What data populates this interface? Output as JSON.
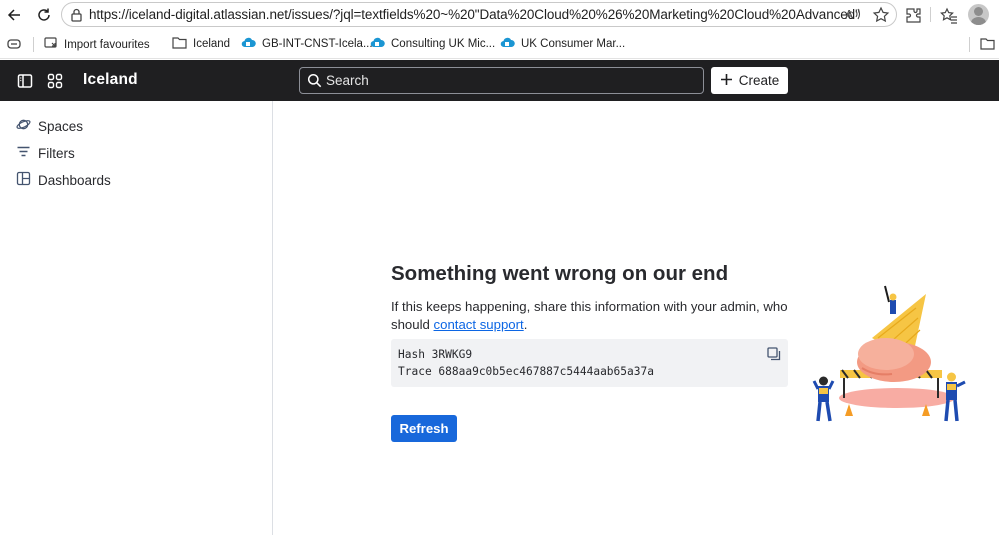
{
  "browser": {
    "url": "https://iceland-digital.atlassian.net/issues/?jql=textfields%20~%20\"Data%20Cloud%20%26%20Marketing%20Cloud%20Advanced\"",
    "bookmarks": [
      {
        "label": "Import favourites",
        "icon": "import-icon"
      },
      {
        "label": "Iceland",
        "icon": "folder-icon"
      },
      {
        "label": "GB-INT-CNST-Icela...",
        "icon": "cloud-icon"
      },
      {
        "label": "Consulting UK Mic...",
        "icon": "cloud-icon"
      },
      {
        "label": "UK Consumer Mar...",
        "icon": "cloud-icon"
      }
    ]
  },
  "topnav": {
    "app_name": "Iceland",
    "search_placeholder": "Search",
    "create_label": "Create"
  },
  "sidebar": {
    "items": [
      {
        "label": "Spaces",
        "icon": "planet-icon"
      },
      {
        "label": "Filters",
        "icon": "filter-icon"
      },
      {
        "label": "Dashboards",
        "icon": "dashboard-icon"
      }
    ]
  },
  "error": {
    "title": "Something went wrong on our end",
    "body_prefix": "If this keeps happening, share this information with your admin, who should ",
    "support_link": "contact support",
    "body_suffix": ".",
    "hash_line": "Hash 3RWKG9",
    "trace_line": "Trace 688aa9c0b5ec467887c5444aab65a37a",
    "refresh_label": "Refresh"
  },
  "colors": {
    "topnav_bg": "#1f1f21",
    "primary": "#1868db",
    "link": "#0c66e4"
  }
}
